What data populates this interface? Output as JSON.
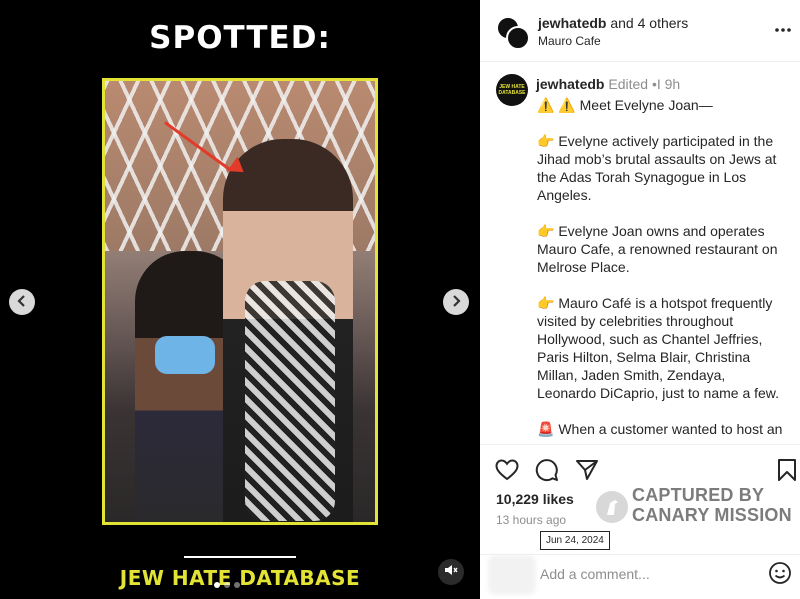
{
  "media": {
    "heading": "SPOTTED:",
    "brand_text": "JEW HATE DATABASE",
    "prev_icon": "chevron-left-icon",
    "next_icon": "chevron-right-icon",
    "mute_icon": "speaker-muted-icon",
    "accent_color": "#e3e335",
    "arrow_color": "#e23b2a"
  },
  "header": {
    "username": "jewhatedb",
    "collab_text": " and 4 others",
    "location": "Mauro Cafe",
    "more_icon": "more-horizontal-icon"
  },
  "caption": {
    "username": "jewhatedb",
    "meta": " Edited •I 9h",
    "avatar_text": "JEW HATE DATABASE",
    "lines": [
      "⚠️ ⚠️  Meet Evelyne Joan—",
      "👉  Evelyne actively participated in the Jihad mob’s brutal assaults on Jews at the Adas Torah Synagogue in Los Angeles.",
      "👉  Evelyne Joan owns and operates Mauro Cafe, a renowned restaurant on Melrose Place.",
      "👉  Mauro Café is a hotspot frequently visited by celebrities throughout Hollywood, such as Chantel Jeffries, Paris Hilton, Selma Blair, Christina Millan, Jaden Smith, Zendaya, Leonardo DiCaprio, just to name a few.",
      "🚨  When a customer wanted to host an"
    ]
  },
  "actions": {
    "like_icon": "heart-icon",
    "comment_icon": "comment-icon",
    "share_icon": "share-icon",
    "save_icon": "bookmark-icon",
    "likes": "10,229 likes",
    "time_ago": "13 hours ago",
    "date_tooltip": "Jun 24, 2024"
  },
  "watermark": {
    "line1": "CAPTURED BY",
    "line2": "CANARY MISSION"
  },
  "comment": {
    "placeholder": "Add a comment...",
    "emoji_icon": "smiley-icon"
  }
}
